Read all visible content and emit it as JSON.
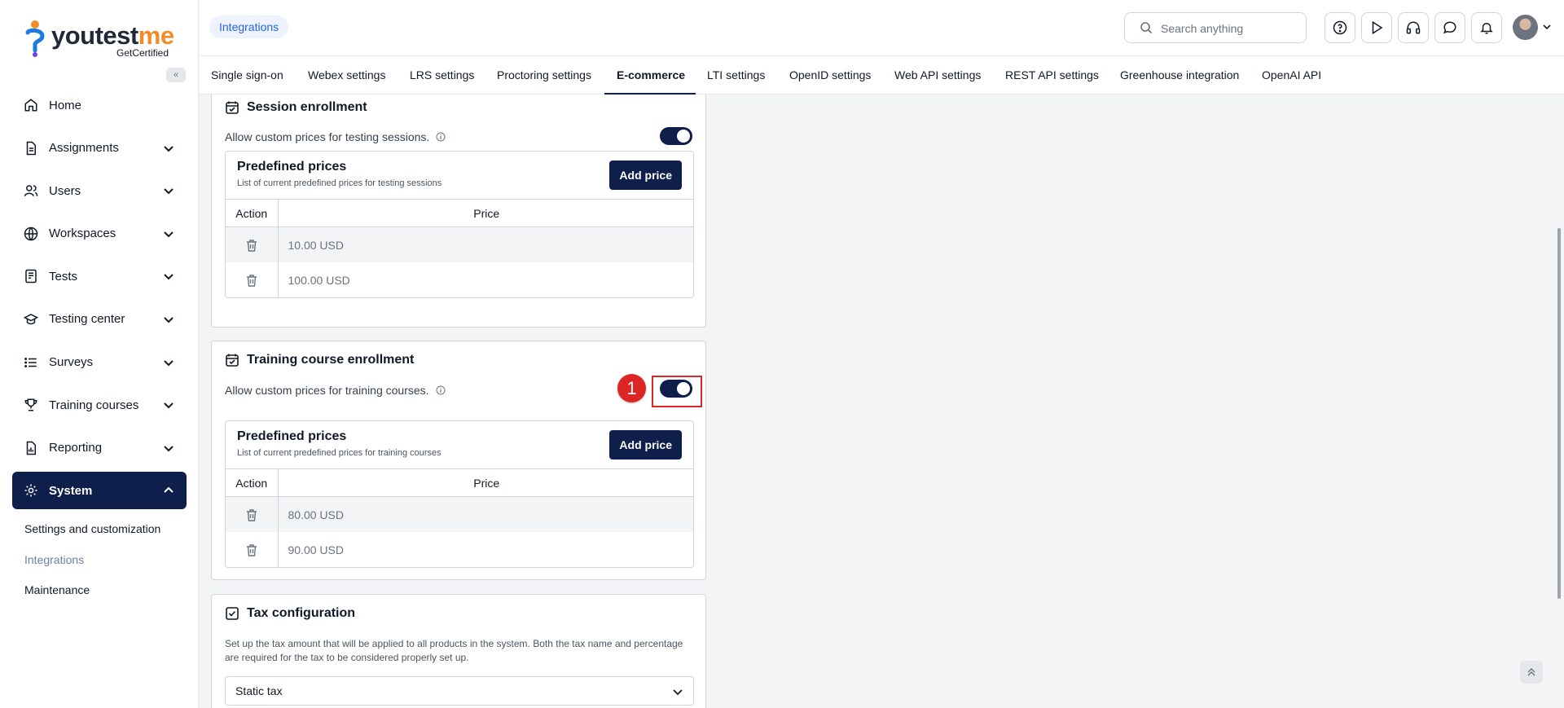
{
  "logo": {
    "brand_a": "youtest",
    "brand_b": "me",
    "tagline": "GetCertified"
  },
  "sidebar": {
    "collapse": "«",
    "items": [
      {
        "label": "Home",
        "icon": "home-icon",
        "expandable": false
      },
      {
        "label": "Assignments",
        "icon": "document-icon",
        "expandable": true
      },
      {
        "label": "Users",
        "icon": "users-icon",
        "expandable": true
      },
      {
        "label": "Workspaces",
        "icon": "globe-icon",
        "expandable": true
      },
      {
        "label": "Tests",
        "icon": "test-icon",
        "expandable": true
      },
      {
        "label": "Testing center",
        "icon": "graduation-icon",
        "expandable": true
      },
      {
        "label": "Surveys",
        "icon": "list-icon",
        "expandable": true
      },
      {
        "label": "Training courses",
        "icon": "trophy-icon",
        "expandable": true
      },
      {
        "label": "Reporting",
        "icon": "report-icon",
        "expandable": true
      },
      {
        "label": "System",
        "icon": "gear-icon",
        "expandable": true,
        "active": true
      }
    ],
    "subitems": [
      "Settings and customization",
      "Integrations",
      "Maintenance"
    ]
  },
  "header": {
    "breadcrumb": "Integrations",
    "search_placeholder": "Search anything"
  },
  "tabs": [
    "Single sign-on",
    "Webex settings",
    "LRS settings",
    "Proctoring settings",
    "E-commerce",
    "LTI settings",
    "OpenID settings",
    "Web API settings",
    "REST API settings",
    "Greenhouse integration",
    "OpenAI API"
  ],
  "active_tab": "E-commerce",
  "session": {
    "title": "Session enrollment",
    "option": "Allow custom prices for testing sessions.",
    "toggle_on": true,
    "prices_title": "Predefined prices",
    "prices_desc": "List of current predefined prices for testing sessions",
    "add_label": "Add price",
    "col_action": "Action",
    "col_price": "Price",
    "rows": [
      "10.00 USD",
      "100.00 USD"
    ]
  },
  "training": {
    "title": "Training course enrollment",
    "option": "Allow custom prices for training courses.",
    "toggle_on": true,
    "prices_title": "Predefined prices",
    "prices_desc": "List of current predefined prices for training courses",
    "add_label": "Add price",
    "col_action": "Action",
    "col_price": "Price",
    "rows": [
      "80.00 USD",
      "90.00 USD"
    ]
  },
  "tax": {
    "title": "Tax configuration",
    "description": "Set up the tax amount that will be applied to all products in the system. Both the tax name and percentage are required for the tax to be considered properly set up.",
    "select_value": "Static tax"
  },
  "annotation": {
    "marker": "1"
  },
  "colors": {
    "navy": "#0f1f4b",
    "accent_blue": "#2563eb",
    "marker_red": "#dc2626",
    "logo_orange": "#f28c28"
  }
}
